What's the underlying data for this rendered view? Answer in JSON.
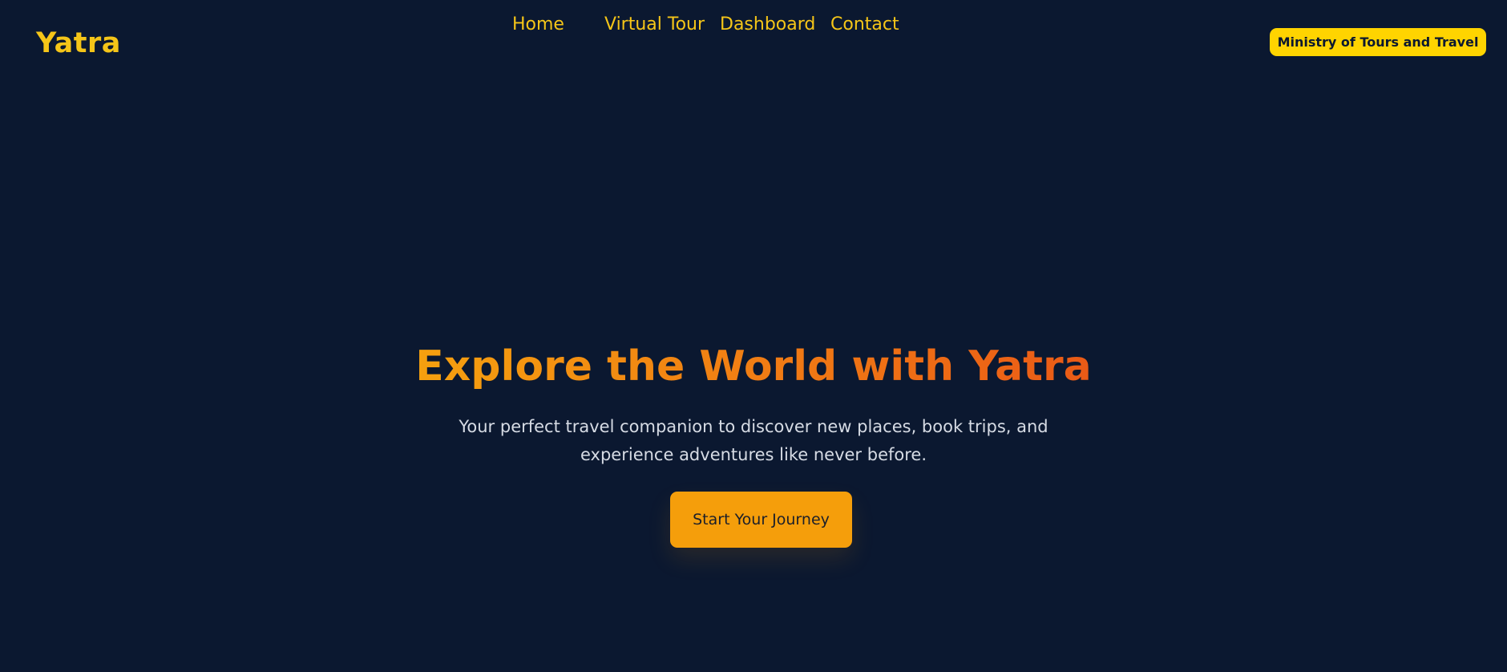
{
  "header": {
    "logo": "Yatra",
    "nav": [
      {
        "label": "Home"
      },
      {
        "label": "Virtual Tour"
      },
      {
        "label": "Dashboard"
      },
      {
        "label": "Contact"
      }
    ],
    "ministry_button": "Ministry of Tours and Travel"
  },
  "hero": {
    "title": "Explore the World with Yatra",
    "subtitle": "Your perfect travel companion to discover new places, book trips, and experience adventures like never before.",
    "cta_label": "Start Your Journey"
  },
  "colors": {
    "background": "#0b1830",
    "accent_yellow": "#f5c518",
    "button_yellow": "#ffd400",
    "cta_orange": "#f59e0b",
    "title_gradient_start": "#f5a00f",
    "title_gradient_end": "#ea5a16"
  }
}
